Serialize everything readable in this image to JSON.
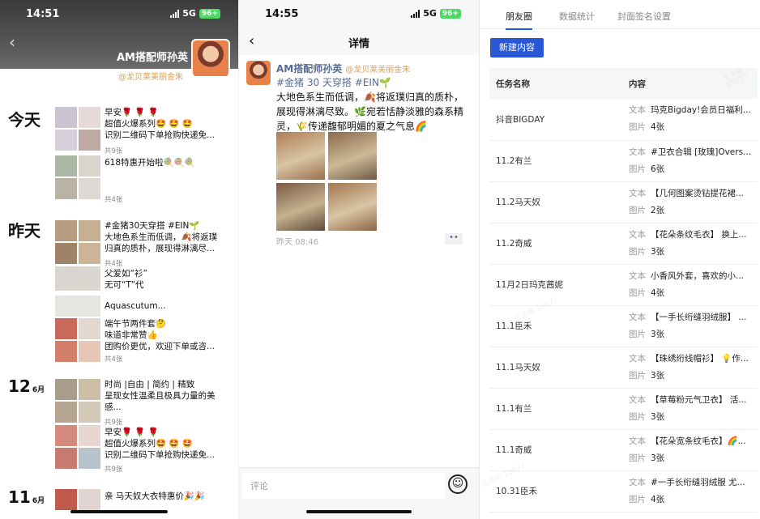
{
  "p1": {
    "status": {
      "time": "14:51",
      "network": "5G",
      "battery": "96+"
    },
    "profile_name": "AM搭配师孙英",
    "signature": "@龙贝莱美丽金朱",
    "days": [
      {
        "label": "今天",
        "posts": [
          {
            "text": "早安🌹 🌹 🌹\n超值火爆系列🤩 🤩 🤩\n识别二维码下单抢购快递免...",
            "count": "共9张"
          },
          {
            "text": "618特惠开始啦🍭🍭🍭",
            "count": "共4张"
          }
        ]
      },
      {
        "label": "昨天",
        "posts": [
          {
            "text": "#金猪30天穿搭 #EIN🌱\n大地色系生而低调，🍂将返璞\n归真的质朴，展现得淋漓尽...",
            "count": "共4张"
          },
          {
            "text": "父爱如“衫”\n无可“T”代",
            "count": ""
          },
          {
            "text": "Aquascutum...",
            "count": ""
          },
          {
            "text": "端午节两件套🤔\n味道非常赞👍\n团购价更优，欢迎下单或咨...",
            "count": "共4张"
          }
        ]
      },
      {
        "label": "12",
        "month": "6月",
        "posts": [
          {
            "text": "时尚 |自由 | 简约 | 精致\n呈现女性温柔且极具力量的美\n感...",
            "count": "共9张"
          },
          {
            "text": "早安🌹 🌹 🌹\n超值火爆系列🤩 🤩 🤩\n识别二维码下单抢购快递免...",
            "count": "共9张"
          }
        ]
      },
      {
        "label": "11",
        "month": "6月",
        "posts": [
          {
            "text": "亲 马天奴大衣特惠价🎉🎉",
            "count": ""
          }
        ]
      }
    ]
  },
  "p2": {
    "status": {
      "time": "14:55",
      "network": "5G",
      "battery": "96+"
    },
    "title": "详情",
    "author": "AM搭配师孙英",
    "author_sub": "@龙贝莱美丽金朱",
    "tags": "#金猪 30 天穿搭 #EIN🌱",
    "body": "大地色系生而低调，🍂将返璞归真的质朴，展现得淋漓尽致。🌿宛若恬静淡雅的森系精灵，🌾传递馥郁明媚的夏之气息🌈",
    "time": "昨天 08:46",
    "comment_placeholder": "评论"
  },
  "p3": {
    "tabs": [
      "朋友圈",
      "数据统计",
      "封面签名设置"
    ],
    "new_button": "新建内容",
    "headers": {
      "name": "任务名称",
      "content": "内容"
    },
    "text_label": "文本",
    "image_label": "图片",
    "rows": [
      {
        "name": "抖音BIGDAY",
        "text": "玛克Bigday!会员日福利...",
        "images": "4张"
      },
      {
        "name": "11.2有兰",
        "text": "#卫衣合辑 [玫瑰]Overs...",
        "images": "6张"
      },
      {
        "name": "11.2马天奴",
        "text": "【几何图案烫钻提花裙...",
        "images": "2张"
      },
      {
        "name": "11.2奇威",
        "text": "【花朵条纹毛衣】 换上...",
        "images": "3张"
      },
      {
        "name": "11月2日玛克茜妮",
        "text": "小香风外套，喜欢的小...",
        "images": "4张"
      },
      {
        "name": "11.1臣禾",
        "text": "【一手长绗缝羽绒服】 ...",
        "images": "3张"
      },
      {
        "name": "11.1马天奴",
        "text": "【珠绣绗线帽衫】 💡作...",
        "images": "3张"
      },
      {
        "name": "11.1有兰",
        "text": "【草莓粉元气卫衣】 活...",
        "images": "3张"
      },
      {
        "name": "11.1奇威",
        "text": "【花朵宽条纹毛衣】🌈...",
        "images": "3张"
      },
      {
        "name": "10.31臣禾",
        "text": "#一手长绗缝羽绒服 尤...",
        "images": "4张"
      }
    ],
    "watermark": "王泽鹏 10077"
  }
}
